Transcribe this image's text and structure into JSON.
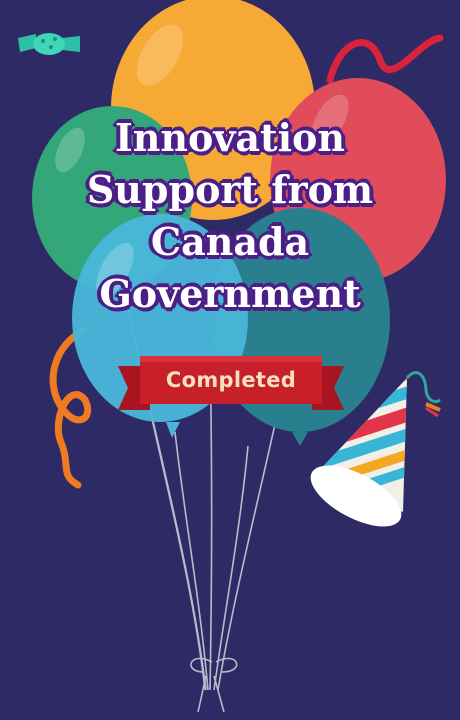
{
  "card": {
    "title_lines": [
      "Innovation",
      "Support from",
      "Canada",
      "Government"
    ],
    "status_label": "Completed",
    "colors": {
      "background": "#2d2a66",
      "title_text": "#ffffff",
      "title_outline": "#4b1f86",
      "ribbon": "#c8202a",
      "ribbon_text": "#f7e0bf"
    },
    "icons": [
      "balloon-bunch-icon",
      "party-hat-icon",
      "candy-icon",
      "streamer-icon"
    ]
  }
}
